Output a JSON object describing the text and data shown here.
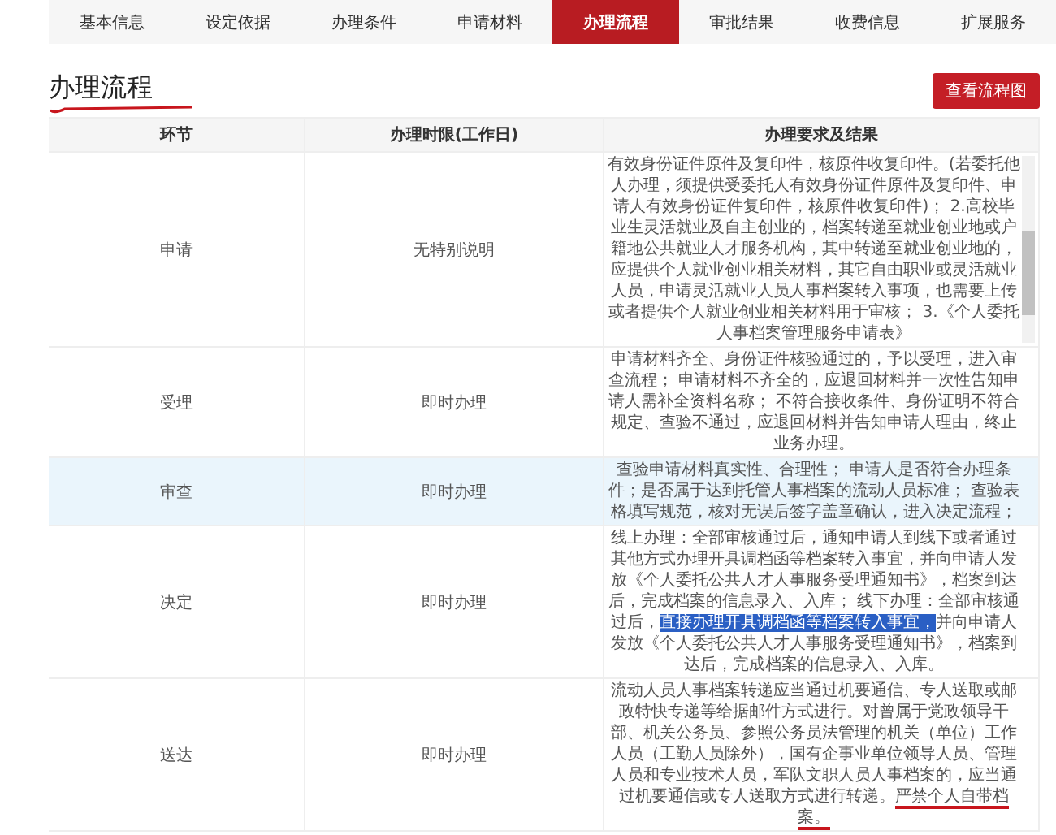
{
  "tabs": [
    {
      "label": "基本信息",
      "selected": false
    },
    {
      "label": "设定依据",
      "selected": false
    },
    {
      "label": "办理条件",
      "selected": false
    },
    {
      "label": "申请材料",
      "selected": false
    },
    {
      "label": "办理流程",
      "selected": true
    },
    {
      "label": "审批结果",
      "selected": false
    },
    {
      "label": "收费信息",
      "selected": false
    },
    {
      "label": "扩展服务",
      "selected": false
    }
  ],
  "section": {
    "title": "办理流程",
    "button": "查看流程图"
  },
  "table": {
    "columns": [
      "环节",
      "办理时限(工作日)",
      "办理要求及结果"
    ],
    "rows": [
      {
        "selected": false,
        "step": "申请",
        "time": "无特别说明",
        "requirement": [
          {
            "text": "有效身份证件原件及复印件，核原件收复印件。(若委托他人办理，须提供受委托人有效身份证件原件及复印件、申请人有效身份证件复印件，核原件收复印件)； 2.高校毕业生灵活就业及自主创业的，档案转递至就业创业地或户籍地公共就业人才服务机构，其中转递至就业创业地的，应提供个人就业创业相关材料，其它自由职业或灵活就业人员，申请灵活就业人员人事档案转入事项，也需要上传或者提供个人就业创业相关材料用于审核； 3.《个人委托人事档案管理服务申请表》",
            "kind": "plain"
          }
        ]
      },
      {
        "selected": false,
        "step": "受理",
        "time": "即时办理",
        "requirement": [
          {
            "text": "申请材料齐全、身份证件核验通过的，予以受理，进入审查流程； 申请材料不齐全的，应退回材料并一次性告知申请人需补全资料名称； 不符合接收条件、身份证明不符合规定、查验不通过，应退回材料并告知申请人理由，终止业务办理。",
            "kind": "plain"
          }
        ]
      },
      {
        "selected": true,
        "step": "审查",
        "time": "即时办理",
        "requirement": [
          {
            "text": "查验申请材料真实性、合理性； 申请人是否符合办理条件；是否属于达到托管人事档案的流动人员标准； 查验表格填写规范，核对无误后签字盖章确认，进入决定流程；",
            "kind": "plain"
          }
        ]
      },
      {
        "selected": false,
        "step": "决定",
        "time": "即时办理",
        "requirement": [
          {
            "text": "线上办理：全部审核通过后，通知申请人到线下或者通过其他方式办理开具调档函等档案转入事宜，并向申请人发放《个人委托公共人才人事服务受理通知书》，档案到达后，完成档案的信息录入、入库； 线下办理：全部审核通过后，",
            "kind": "plain"
          },
          {
            "text": "直接办理开具调档函等档案转入事宜，",
            "kind": "highlight"
          },
          {
            "text": "并向申请人发放《个人委托公共人才人事服务受理通知书》，档案到达后，完成档案的信息录入、入库。",
            "kind": "plain"
          }
        ]
      },
      {
        "selected": false,
        "step": "送达",
        "time": "即时办理",
        "requirement": [
          {
            "text": "流动人员人事档案转递应当通过机要通信、专人送取或邮政特快专递等给据邮件方式进行。对曾属于党政领导干部、机关公务员、参照公务员法管理的机关（单位）工作人员（工勤人员除外），国有企事业单位领导人员、管理人员和专业技术人员，军队文职人员人事档案的，应当通过机要通信或专人送取方式进行转递。",
            "kind": "plain"
          },
          {
            "text": "严禁个人自带档案。",
            "kind": "underline"
          }
        ]
      }
    ]
  }
}
